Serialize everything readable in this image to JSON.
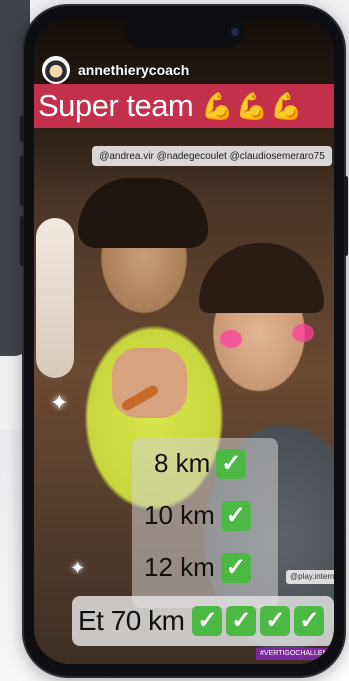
{
  "story": {
    "username": "annethierycoach",
    "title": "Super team",
    "title_icons": [
      "flexed-biceps-icon",
      "flexed-biceps-icon",
      "flexed-biceps-icon"
    ],
    "mentions": "@andrea.vir @nadegecoulet @claudiosemeraro75",
    "distances": [
      {
        "label": "8 km",
        "checks": 1
      },
      {
        "label": "10 km",
        "checks": 1
      },
      {
        "label": "12 km",
        "checks": 1
      }
    ],
    "final": {
      "label": "Et 70 km",
      "checks": 4
    },
    "tag_play": "@play.internat",
    "hashtag": "#VERTIGOCHALLENGE",
    "check_glyph": "✓"
  },
  "colors": {
    "banner": "#c2304a",
    "check": "#4cb944",
    "hashtag_bg": "#7a2a9a"
  }
}
